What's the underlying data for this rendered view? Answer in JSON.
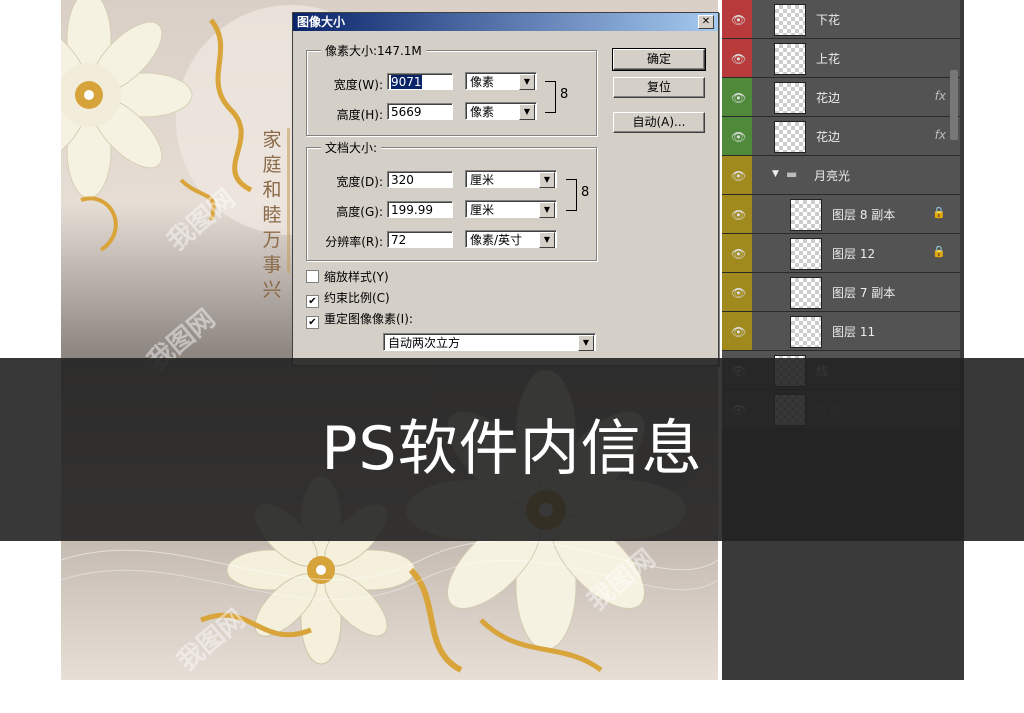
{
  "artwork": {
    "vertical_text": "家庭和睦万事兴",
    "watermark": "我图网"
  },
  "dialog": {
    "title": "图像大小",
    "close_glyph": "✕",
    "pixel_size_label": "像素大小:147.1M",
    "width_label": "宽度(W):",
    "width_value": "9071",
    "width_unit": "像素",
    "height_label": "高度(H):",
    "height_value": "5669",
    "height_unit": "像素",
    "doc_size_label": "文档大小:",
    "doc_width_label": "宽度(D):",
    "doc_width_value": "320",
    "doc_width_unit": "厘米",
    "doc_height_label": "高度(G):",
    "doc_height_value": "199.99",
    "doc_height_unit": "厘米",
    "resolution_label": "分辨率(R):",
    "resolution_value": "72",
    "resolution_unit": "像素/英寸",
    "scale_styles": {
      "label": "缩放样式(Y)",
      "checked": false
    },
    "constrain": {
      "label": "约束比例(C)",
      "checked": true
    },
    "resample": {
      "label": "重定图像像素(I):",
      "checked": true
    },
    "resample_method": "自动两次立方",
    "ok_button": "确定",
    "reset_button": "复位",
    "auto_button": "自动(A)...",
    "dropdown_glyph": "▼",
    "link_glyph": "8"
  },
  "layers": [
    {
      "name": "下花",
      "color": "#b83a3a",
      "fx": false,
      "lock": false,
      "indent": 0
    },
    {
      "name": "上花",
      "color": "#b83a3a",
      "fx": false,
      "lock": false,
      "indent": 0
    },
    {
      "name": "花边",
      "color": "#4f8a3b",
      "fx": true,
      "lock": false,
      "indent": 0
    },
    {
      "name": "花边",
      "color": "#4f8a3b",
      "fx": true,
      "lock": false,
      "indent": 0
    },
    {
      "name": "月亮光",
      "color": "#a08a1e",
      "group": true,
      "indent": 0
    },
    {
      "name": "图层 8 副本",
      "color": "#a08a1e",
      "fx": false,
      "lock": true,
      "indent": 1
    },
    {
      "name": "图层 12",
      "color": "#a08a1e",
      "fx": false,
      "lock": true,
      "indent": 1
    },
    {
      "name": "图层 7 副本",
      "color": "#a08a1e",
      "fx": false,
      "lock": false,
      "indent": 1
    },
    {
      "name": "图层 11",
      "color": "#a08a1e",
      "fx": false,
      "lock": false,
      "indent": 1
    },
    {
      "name": "线",
      "color": "#535353",
      "fx": false,
      "lock": false,
      "indent": 0
    },
    {
      "name": "背景",
      "color": "#535353",
      "fx": false,
      "lock": false,
      "indent": 0
    }
  ],
  "fx_text": "fx",
  "lock_text": "🔒",
  "eye_text": "👁",
  "group_arrow": "▼",
  "banner": {
    "caption": "PS软件内信息"
  }
}
